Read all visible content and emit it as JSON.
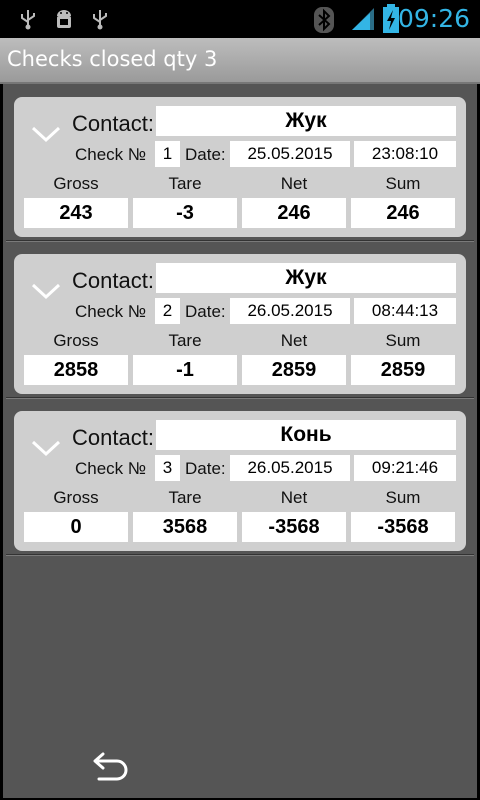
{
  "status_bar": {
    "time": "09:26",
    "left_icons": [
      "usb-icon",
      "android-debug-icon",
      "usb-icon"
    ],
    "right_icons": [
      "bluetooth-icon",
      "signal-icon",
      "battery-charging-icon"
    ],
    "accent": "#33b5e5"
  },
  "header": {
    "title": "Checks closed qty 3"
  },
  "labels": {
    "contact": "Contact:",
    "check": "Check №",
    "date": "Date:",
    "gross": "Gross",
    "tare": "Tare",
    "net": "Net",
    "sum": "Sum"
  },
  "checks": [
    {
      "contact": "Жук",
      "number": "1",
      "date": "25.05.2015",
      "time": "23:08:10",
      "gross": "243",
      "tare": "-3",
      "net": "246",
      "sum": "246"
    },
    {
      "contact": "Жук",
      "number": "2",
      "date": "26.05.2015",
      "time": "08:44:13",
      "gross": "2858",
      "tare": "-1",
      "net": "2859",
      "sum": "2859"
    },
    {
      "contact": "Конь",
      "number": "3",
      "date": "26.05.2015",
      "time": "09:21:46",
      "gross": "0",
      "tare": "3568",
      "net": "-3568",
      "sum": "-3568"
    }
  ],
  "footer": {
    "back_icon": "back-icon"
  }
}
